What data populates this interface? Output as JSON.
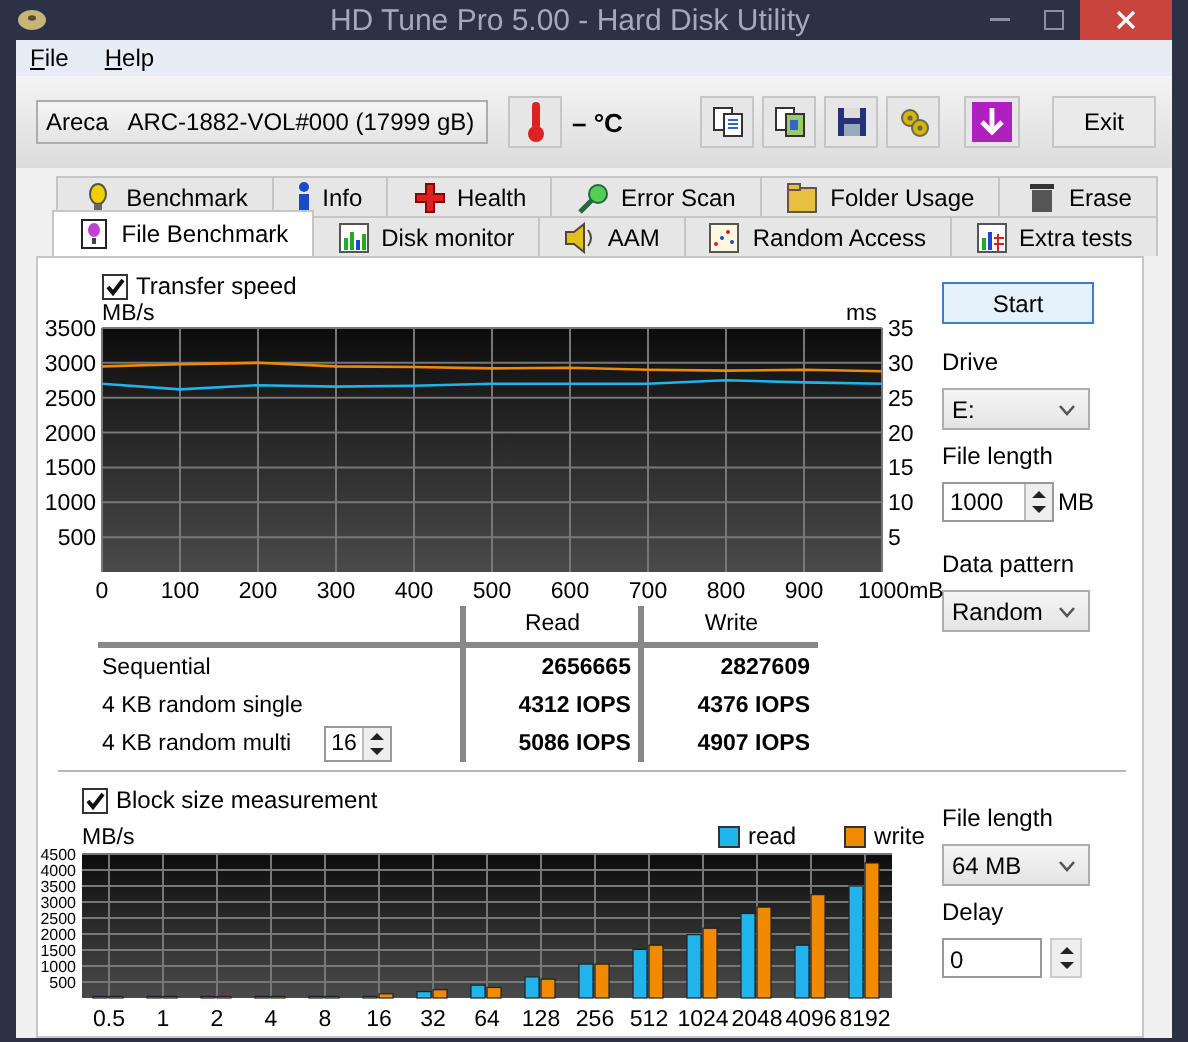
{
  "window": {
    "title": "HD Tune Pro 5.00 - Hard Disk Utility"
  },
  "menu": [
    {
      "label": "File"
    },
    {
      "label": "Help"
    }
  ],
  "toolbar": {
    "drive": "Areca   ARC-1882-VOL#000 (17999 gB)",
    "temperature": "– °C",
    "exit": "Exit"
  },
  "tabs_top": [
    {
      "label": "Benchmark",
      "kind": "bulb",
      "selected": false
    },
    {
      "label": "Info",
      "kind": "info",
      "selected": false
    },
    {
      "label": "Health",
      "kind": "cross",
      "selected": false
    },
    {
      "label": "Error Scan",
      "kind": "magnifier",
      "selected": false
    },
    {
      "label": "Folder Usage",
      "kind": "folder",
      "selected": false
    },
    {
      "label": "Erase",
      "kind": "bin",
      "selected": false
    }
  ],
  "tabs_bottom": [
    {
      "label": "File Benchmark",
      "kind": "file",
      "selected": true
    },
    {
      "label": "Disk monitor",
      "kind": "bars",
      "selected": false
    },
    {
      "label": "AAM",
      "kind": "speaker",
      "selected": false
    },
    {
      "label": "Random Access",
      "kind": "dots",
      "selected": false
    },
    {
      "label": "Extra tests",
      "kind": "grid",
      "selected": false
    }
  ],
  "transfer": {
    "checkbox": {
      "label": "Transfer speed",
      "checked": true
    },
    "chart_data": {
      "type": "line",
      "ylabel": "MB/s",
      "ylim": [
        0,
        3500
      ],
      "yticks": [
        500,
        1000,
        1500,
        2000,
        2500,
        3000,
        3500
      ],
      "y2label": "ms",
      "y2lim": [
        0,
        35
      ],
      "y2ticks": [
        5,
        10,
        15,
        20,
        25,
        30,
        35
      ],
      "grid": true,
      "categories": [
        "0",
        "100",
        "200",
        "300",
        "400",
        "500",
        "600",
        "700",
        "800",
        "900",
        "1000mB"
      ],
      "series": [
        {
          "color": "#1fb4ec",
          "values": [
            2700,
            2620,
            2680,
            2660,
            2670,
            2700,
            2700,
            2700,
            2750,
            2720,
            2700
          ]
        },
        {
          "color": "#f28a00",
          "values": [
            2950,
            2980,
            3000,
            2950,
            2940,
            2920,
            2930,
            2900,
            2890,
            2900,
            2880
          ]
        }
      ]
    }
  },
  "results": {
    "columns": [
      "Read",
      "Write"
    ],
    "rows": [
      {
        "label": "Sequential",
        "read": "2656665",
        "write": "2827609"
      },
      {
        "label": "4 KB random single",
        "read": "4312 IOPS",
        "write": "4376 IOPS"
      },
      {
        "label": "4 KB random multi",
        "queue": "16",
        "read": "5086 IOPS",
        "write": "4907 IOPS"
      }
    ]
  },
  "side": {
    "start": "Start",
    "drive_label": "Drive",
    "drive": "E:",
    "length_label": "File length",
    "length": "1000",
    "unit": "MB",
    "pattern_label": "Data pattern",
    "pattern": "Random"
  },
  "block": {
    "checkbox": {
      "label": "Block size measurement",
      "checked": true
    },
    "chart_data": {
      "type": "bar",
      "ylabel": "MB/s",
      "ylim": [
        0,
        4500
      ],
      "yticks": [
        500,
        1000,
        1500,
        2000,
        2500,
        3000,
        3500,
        4000,
        4500
      ],
      "grid": true,
      "categories": [
        "0.5",
        "1",
        "2",
        "4",
        "8",
        "16",
        "32",
        "64",
        "128",
        "256",
        "512",
        "1024",
        "2048",
        "4096",
        "8192"
      ],
      "series": [
        {
          "name": "read",
          "color": "#1fb4ec",
          "values": [
            50,
            50,
            50,
            50,
            50,
            50,
            200,
            400,
            660,
            1060,
            1520,
            1980,
            2640,
            1650,
            3500
          ]
        },
        {
          "name": "write",
          "color": "#f28a00",
          "values": [
            50,
            50,
            50,
            50,
            50,
            130,
            260,
            330,
            590,
            1060,
            1650,
            2180,
            2840,
            3230,
            4220
          ]
        }
      ]
    },
    "length_label": "File length",
    "length": "64 MB",
    "delay_label": "Delay",
    "delay": "0"
  }
}
